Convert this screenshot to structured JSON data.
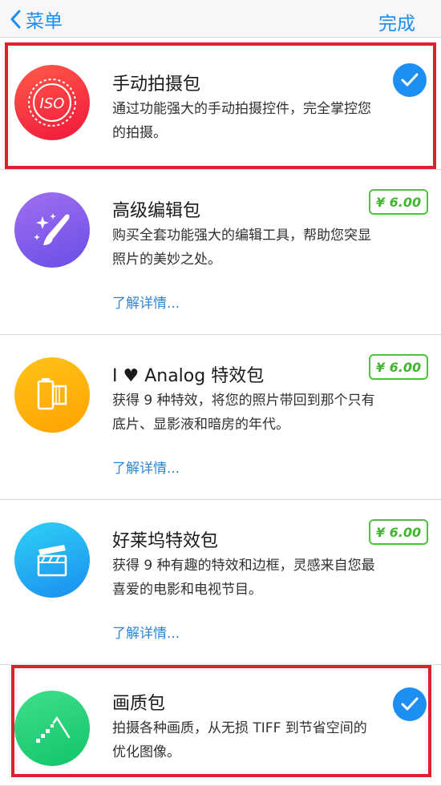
{
  "nav": {
    "back_label": "菜单",
    "done_label": "完成"
  },
  "colors": {
    "accent": "#1a8ef0",
    "price_green": "#3fb52e",
    "highlight_red": "#d9222e"
  },
  "packs": [
    {
      "icon": "iso-icon",
      "title": "手动拍摄包",
      "desc_line1": "通过功能强大的手动拍摄控件，完全掌控您",
      "desc_line2": "的拍摄。",
      "status": "purchased"
    },
    {
      "icon": "paintbrush-sparkles-icon",
      "title": "高级编辑包",
      "desc_line1": "购买全套功能强大的编辑工具，帮助您突显",
      "desc_line2": "照片的美妙之处。",
      "more": "了解详情...",
      "price": "¥ 6.00"
    },
    {
      "icon": "film-roll-icon",
      "title": "I ♥ Analog 特效包",
      "desc_line1": "获得 9 种特效，将您的照片带回到那个只有",
      "desc_line2": "底片、显影液和暗房的年代。",
      "more": "了解详情...",
      "price": "¥ 6.00"
    },
    {
      "icon": "clapperboard-icon",
      "title": "好莱坞特效包",
      "desc_line1": "获得 9 种有趣的特效和边框，灵感来自您最",
      "desc_line2": "喜爱的电影和电视节目。",
      "more": "了解详情...",
      "price": "¥ 6.00"
    },
    {
      "icon": "image-quality-icon",
      "title": "画质包",
      "desc_line1": "拍摄各种画质，从无损 TIFF 到节省空间的",
      "desc_line2": "优化图像。",
      "status": "purchased"
    }
  ],
  "iso_text": "ISO"
}
